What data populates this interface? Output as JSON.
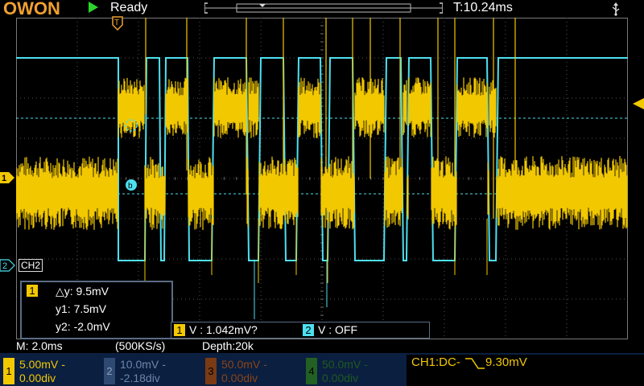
{
  "header": {
    "brand": "OWON",
    "status": "Ready",
    "trigger_position": "T:10.24ms",
    "usb_icon": "usb-icon"
  },
  "markers": {
    "trigger_marker": "T",
    "ch1_marker": "1",
    "ch2_marker": "2",
    "ch2_label": "CH2",
    "cursor_a": "a",
    "cursor_b": "b"
  },
  "measure": {
    "channel": "1",
    "delta_y": "△y: 9.5mV",
    "y1": "y1: 7.5mV",
    "y2": "y2: -2.0mV"
  },
  "cursor_readout": {
    "ch1_badge": "1",
    "ch1_value": "V : 1.042mV?",
    "ch2_badge": "2",
    "ch2_value": "V : OFF"
  },
  "info": {
    "timebase": "M: 2.0ms",
    "sample_rate": "(500KS/s)",
    "depth": "Depth:20k"
  },
  "channels": [
    {
      "num": "1",
      "scale": "5.00mV",
      "offset": "0.00div",
      "color": "#f2c800",
      "active": true
    },
    {
      "num": "2",
      "scale": "10.0mV",
      "offset": "-2.18div",
      "color": "#4a6690",
      "active": false
    },
    {
      "num": "3",
      "scale": "50.0mV",
      "offset": "0.00div",
      "color": "#9a4a1a",
      "active": false
    },
    {
      "num": "4",
      "scale": "50.0mV",
      "offset": "0.00div",
      "color": "#2e7a2e",
      "active": false
    }
  ],
  "trigger": {
    "source": "CH1:DC-",
    "level": "9.30mV"
  },
  "colors": {
    "ch1": "#f2c800",
    "ch2": "#4de0f0",
    "accent": "#f0a030",
    "grid": "#5a5a5a"
  }
}
